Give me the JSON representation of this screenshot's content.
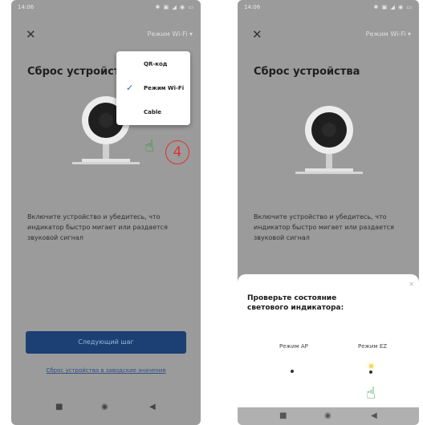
{
  "left_phone": {
    "status_time": "14:06",
    "status_icons": "✱ ▣ ◢ ◉ ▭",
    "close_label": "✕",
    "mode_link": "Режим Wi-Fi ▾",
    "title": "Сброс устройства",
    "dropdown": {
      "items": [
        {
          "label": "QR-код"
        },
        {
          "label": "Режим Wi-Fi"
        },
        {
          "label": "Cable"
        }
      ],
      "check_glyph": "✓"
    },
    "step_number": "4",
    "description": "Включите устройство и убедитесь, что индикатор быстро мигает или раздается звуковой сигнал",
    "next_button": "Следующий шаг",
    "alt_link": "Сброс устройства в заводские значения"
  },
  "right_phone": {
    "status_time": "14:06",
    "status_icons": "✱ ▣ ◢ ◉ ▭",
    "close_label": "✕",
    "mode_link": "Режим Wi-Fi ▾",
    "title": "Сброс устройства",
    "description": "Включите устройство и убедитесь, что индикатор быстро мигает или раздается звуковой сигнал",
    "sheet": {
      "title": "Проверьте состояние светового индикатора:",
      "close_label": "✕",
      "option_ap": "Режим AP",
      "option_ez": "Режим EZ"
    }
  },
  "nav": {
    "back": "■",
    "home": "◉",
    "recent": "◀"
  },
  "icons": {
    "camera": "camera-icon",
    "hand": "pointing-hand-icon",
    "check": "check-icon"
  },
  "colors": {
    "phone_bg": "#9b9b9b",
    "next_button": "#1c3f74",
    "check": "#2f65c8",
    "step_circle": "#e03030",
    "hand": "#1b9a2c",
    "ez_light": "#f2d86b"
  }
}
